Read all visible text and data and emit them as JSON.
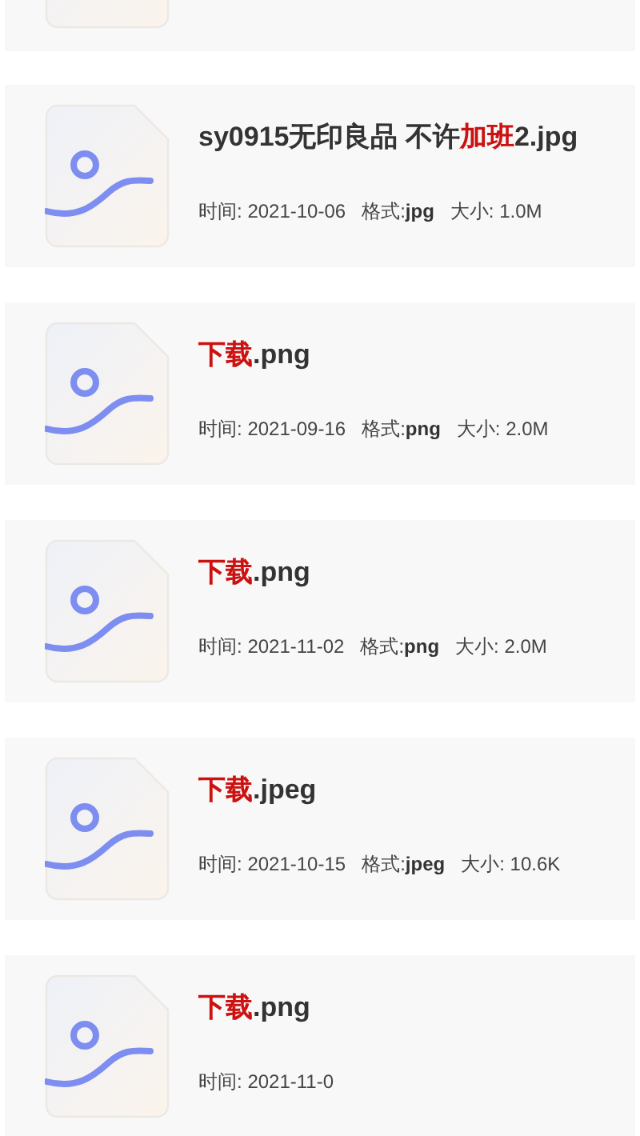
{
  "files": [
    {
      "title": [
        {
          "text": "sy0915无印良品 不许",
          "highlight": false
        },
        {
          "text": "加班",
          "highlight": true
        },
        {
          "text": "2.jpg",
          "highlight": false
        }
      ],
      "time_label": "时间:",
      "time": "2021-10-06",
      "format_label": "格式:",
      "format": "jpg",
      "size_label": "大小:",
      "size": "1.0M"
    },
    {
      "title": [
        {
          "text": "下载",
          "highlight": true
        },
        {
          "text": ".png",
          "highlight": false
        }
      ],
      "time_label": "时间:",
      "time": "2021-09-16",
      "format_label": "格式:",
      "format": "png",
      "size_label": "大小:",
      "size": "2.0M"
    },
    {
      "title": [
        {
          "text": "下载",
          "highlight": true
        },
        {
          "text": ".png",
          "highlight": false
        }
      ],
      "time_label": "时间:",
      "time": "2021-11-02",
      "format_label": "格式:",
      "format": "png",
      "size_label": "大小:",
      "size": "2.0M"
    },
    {
      "title": [
        {
          "text": "下载",
          "highlight": true
        },
        {
          "text": ".jpeg",
          "highlight": false
        }
      ],
      "time_label": "时间:",
      "time": "2021-10-15",
      "format_label": "格式:",
      "format": "jpeg",
      "size_label": "大小:",
      "size": "10.6K"
    },
    {
      "title": [
        {
          "text": "下载",
          "highlight": true
        },
        {
          "text": ".png",
          "highlight": false
        }
      ],
      "time_label": "时间:",
      "time": "2021-11-0"
    }
  ]
}
